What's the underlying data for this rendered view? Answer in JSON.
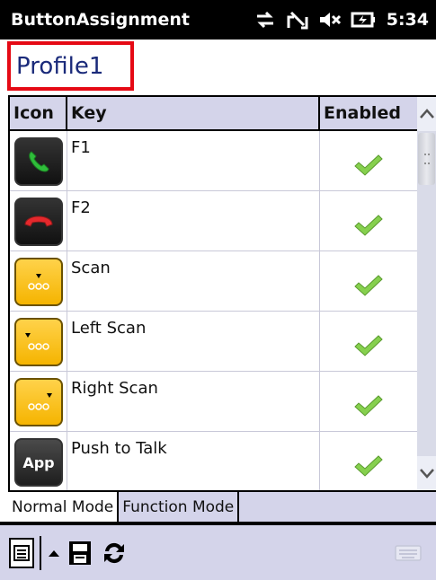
{
  "status_bar": {
    "app_title": "ButtonAssignment",
    "time": "5:34",
    "icons": [
      "connectivity-icon",
      "no-signal-icon",
      "volume-muted-icon",
      "battery-charging-icon"
    ]
  },
  "profile": {
    "name": "Profile1"
  },
  "table": {
    "headers": {
      "icon": "Icon",
      "key": "Key",
      "enabled": "Enabled"
    },
    "rows": [
      {
        "key": "F1",
        "icon": "green-phone-icon",
        "enabled": true
      },
      {
        "key": "F2",
        "icon": "red-phone-icon",
        "enabled": true
      },
      {
        "key": "Scan",
        "icon": "scan-icon",
        "enabled": true
      },
      {
        "key": "Left Scan",
        "icon": "left-scan-icon",
        "enabled": true
      },
      {
        "key": "Right Scan",
        "icon": "right-scan-icon",
        "enabled": true
      },
      {
        "key": "Push to Talk",
        "icon": "app-icon",
        "enabled": true,
        "icon_label": "App"
      }
    ]
  },
  "tabs": [
    {
      "label": "Normal Mode",
      "active": true
    },
    {
      "label": "Function Mode",
      "active": false
    }
  ],
  "toolbar": {
    "icons": [
      "menu-icon",
      "up-arrow-icon",
      "save-icon",
      "refresh-icon",
      "keyboard-icon"
    ]
  },
  "colors": {
    "header_bg": "#d4d4ea",
    "profile_border": "#e50914",
    "check_green": "#7cc84a",
    "scan_yellow": "#f5b400"
  }
}
